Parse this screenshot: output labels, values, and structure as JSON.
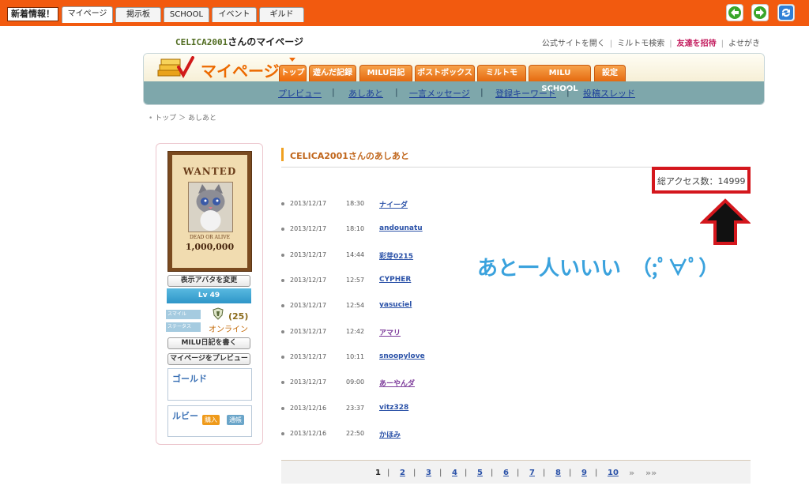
{
  "topbar": {
    "news_label": "新着情報！",
    "tabs": [
      {
        "label": "マイページ",
        "active": true
      },
      {
        "label": "掲示板",
        "active": false
      },
      {
        "label": "SCHOOL",
        "active": false
      },
      {
        "label": "イベント",
        "active": false
      },
      {
        "label": "ギルド",
        "active": false
      }
    ],
    "controls": [
      "back-icon",
      "forward-icon",
      "reload-icon"
    ]
  },
  "header": {
    "username": "CELICA2001",
    "title_suffix": "さんのマイページ",
    "links": [
      "公式サイトを開く",
      "ミルトモ検索",
      "友達を招待",
      "よせがき"
    ]
  },
  "mypage_nav": {
    "title": "マイページ",
    "tabs": [
      "トップ",
      "遊んだ記録",
      "MILU日記",
      "ポストボックス",
      "ミルトモ",
      "MILU SCHOOL",
      "設定"
    ],
    "sublinks": [
      "プレビュー",
      "あしあと",
      "一言メッセージ",
      "登録キーワード",
      "投稿スレッド"
    ]
  },
  "breadcrumb": {
    "items": [
      "トップ",
      "あしあと"
    ],
    "separator": "＞"
  },
  "profile": {
    "wanted_title": "WANTED",
    "wanted_subtitle": "DEAD OR ALIVE",
    "wanted_bounty": "1,000,000",
    "change_avatar_button": "表示アバタを変更",
    "level": "Lv 49",
    "smile_label": "スマイル",
    "status_label": "ステータス",
    "score": "(25)",
    "online": "オンライン",
    "diary_button": "MILU日記を書く",
    "preview_button": "マイページをプレビュー",
    "gold_label": "ゴールド",
    "ruby_label": "ルビー",
    "buy_label": "購入",
    "history_label": "通帳"
  },
  "main": {
    "title": "CELICA2001さんのあしあと",
    "access_label": "総アクセス数：",
    "access_count": "14999",
    "annotation": "あと一人いいい　（;ﾟ∀ﾟ）",
    "rows": [
      {
        "date": "2013/12/17",
        "time": "18:30",
        "name": "ナイーダ",
        "visited": false
      },
      {
        "date": "2013/12/17",
        "time": "18:10",
        "name": "andounatu",
        "visited": false
      },
      {
        "date": "2013/12/17",
        "time": "14:44",
        "name": "彩芽0215",
        "visited": false
      },
      {
        "date": "2013/12/17",
        "time": "12:57",
        "name": "CYPHER",
        "visited": false
      },
      {
        "date": "2013/12/17",
        "time": "12:54",
        "name": "yasuciel",
        "visited": false
      },
      {
        "date": "2013/12/17",
        "time": "12:42",
        "name": "アマリ",
        "visited": true
      },
      {
        "date": "2013/12/17",
        "time": "10:11",
        "name": "snoopylove",
        "visited": false
      },
      {
        "date": "2013/12/17",
        "time": "09:00",
        "name": "あーやんダ",
        "visited": true
      },
      {
        "date": "2013/12/16",
        "time": "23:37",
        "name": "vitz328",
        "visited": false
      },
      {
        "date": "2013/12/16",
        "time": "22:50",
        "name": "かほみ",
        "visited": false
      }
    ]
  },
  "pager": {
    "current": "1",
    "pages": [
      "1",
      "2",
      "3",
      "4",
      "5",
      "6",
      "7",
      "8",
      "9",
      "10"
    ],
    "next_label": "»",
    "last_label": "»»"
  },
  "colors": {
    "topbar": "#f25a0f",
    "accent_orange": "#ec6a00",
    "nav_teal": "#7ea7ab",
    "link_blue": "#2b52a8",
    "annotation_blue": "#3aa2dd",
    "highlight_red": "#d4171d"
  }
}
